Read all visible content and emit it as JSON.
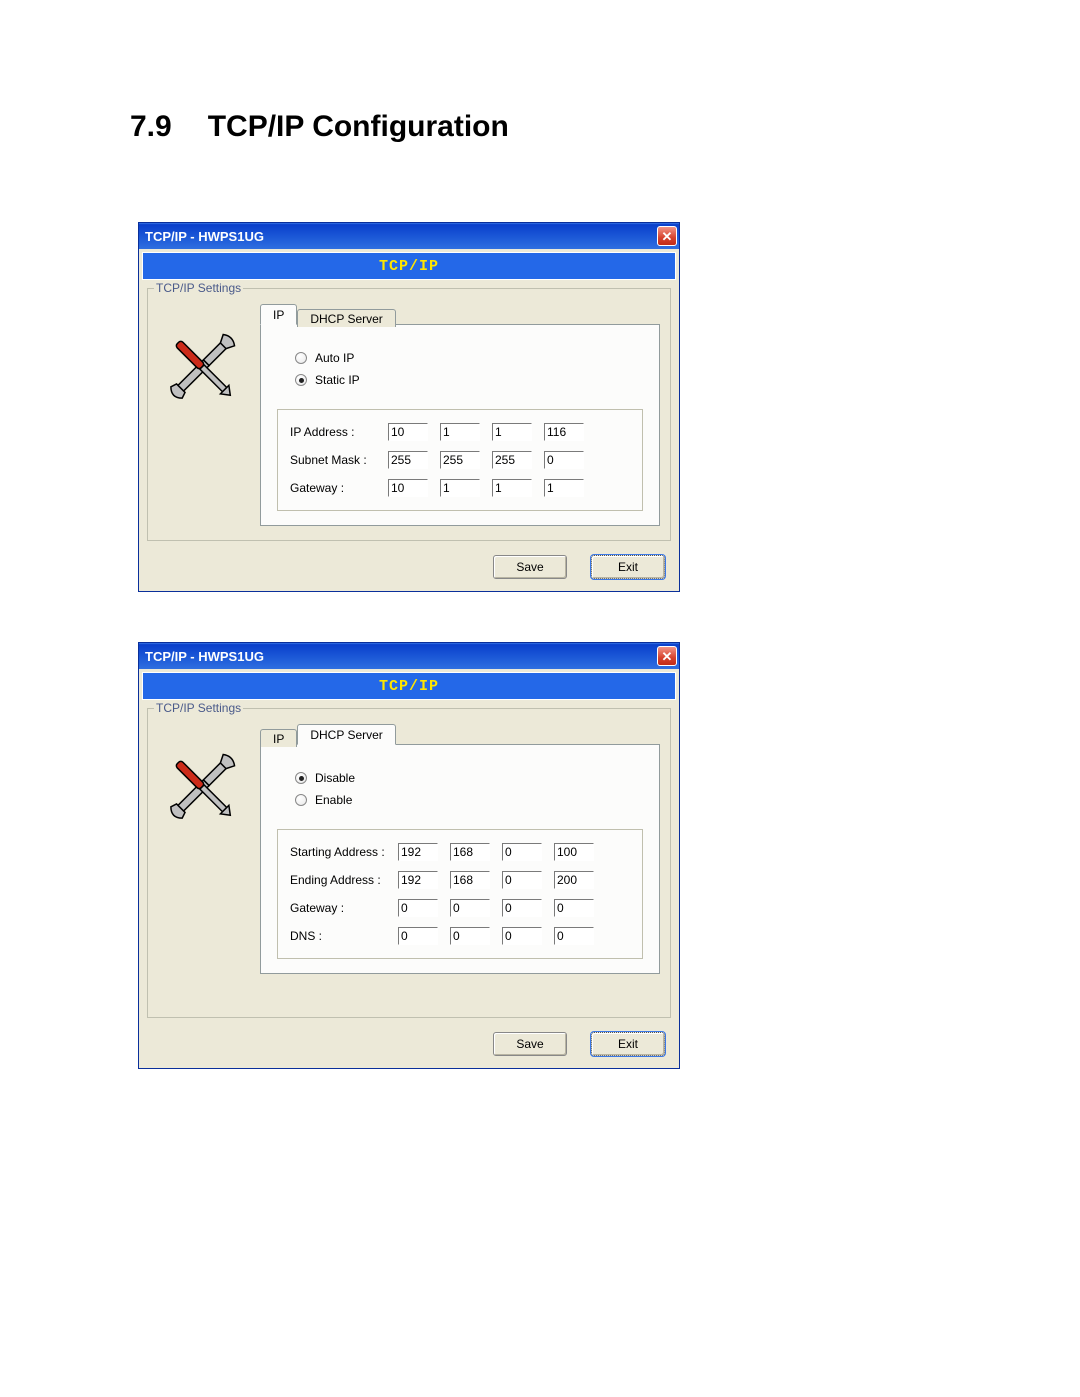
{
  "heading": {
    "num": "7.9",
    "title": "TCP/IP Configuration"
  },
  "dialog1": {
    "title": "TCP/IP - HWPS1UG",
    "banner": "TCP/IP",
    "groupbox_label": "TCP/IP Settings",
    "tabs": {
      "ip": "IP",
      "dhcp": "DHCP Server"
    },
    "radios": {
      "auto": "Auto IP",
      "static": "Static IP"
    },
    "labels": {
      "ip_address": "IP Address :",
      "subnet": "Subnet Mask :",
      "gateway": "Gateway :"
    },
    "ip": [
      "10",
      "1",
      "1",
      "116"
    ],
    "subnet": [
      "255",
      "255",
      "255",
      "0"
    ],
    "gateway": [
      "10",
      "1",
      "1",
      "1"
    ],
    "buttons": {
      "save": "Save",
      "exit": "Exit"
    }
  },
  "dialog2": {
    "title": "TCP/IP - HWPS1UG",
    "banner": "TCP/IP",
    "groupbox_label": "TCP/IP Settings",
    "tabs": {
      "ip": "IP",
      "dhcp": "DHCP Server"
    },
    "radios": {
      "disable": "Disable",
      "enable": "Enable"
    },
    "labels": {
      "start": "Starting Address :",
      "end": "Ending Address :",
      "gateway": "Gateway :",
      "dns": "DNS :"
    },
    "start": [
      "192",
      "168",
      "0",
      "100"
    ],
    "end": [
      "192",
      "168",
      "0",
      "200"
    ],
    "gateway": [
      "0",
      "0",
      "0",
      "0"
    ],
    "dns": [
      "0",
      "0",
      "0",
      "0"
    ],
    "buttons": {
      "save": "Save",
      "exit": "Exit"
    }
  }
}
